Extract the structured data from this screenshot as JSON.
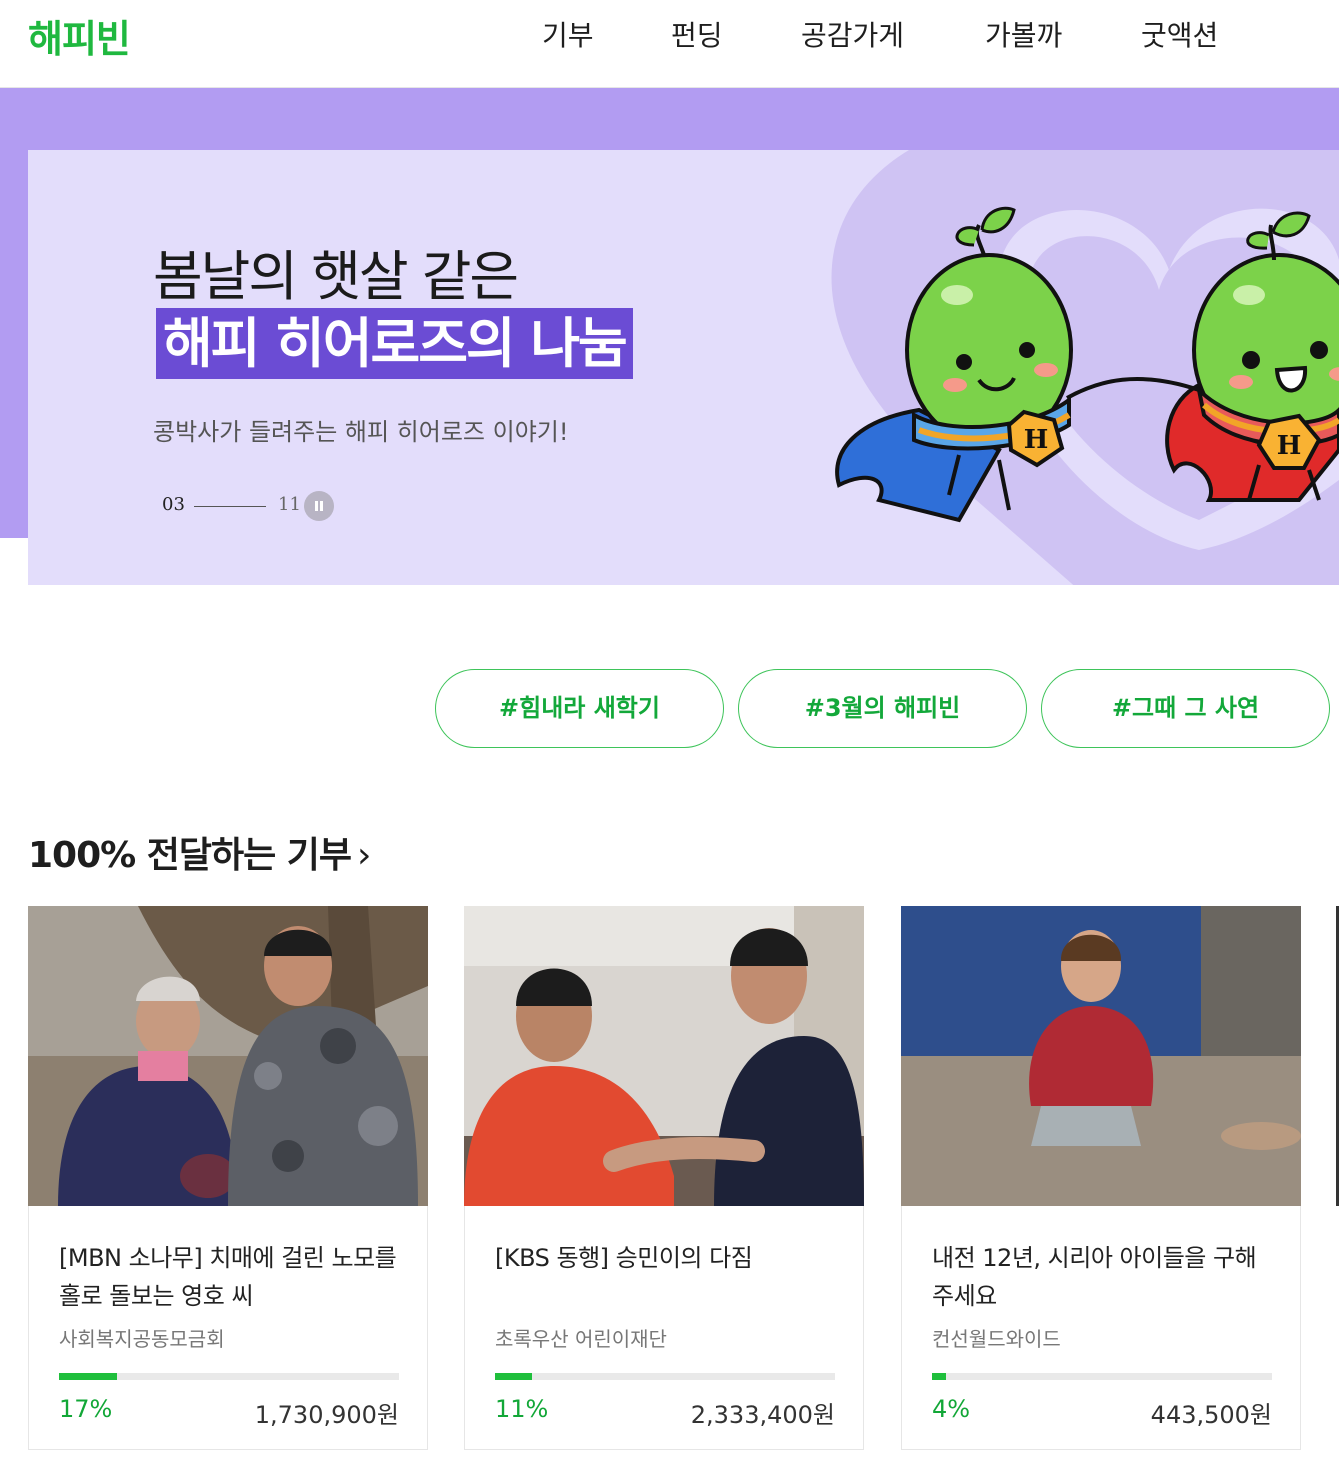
{
  "brand": {
    "logo": "해피빈",
    "accent": "#1fb83f"
  },
  "nav": {
    "items": [
      "기부",
      "펀딩",
      "공감가게",
      "가볼까",
      "굿액션"
    ]
  },
  "hero": {
    "title_line1": "봄날의 햇살 같은",
    "title_line2": "해피 히어로즈의 나눔",
    "subtitle": "콩박사가 들려주는 해피 히어로즈 이야기!",
    "slide_current": "03",
    "slide_total": "11",
    "mascot_badge": "H",
    "colors": {
      "band": "#b29cf2",
      "card": "#e3ddfb",
      "highlight": "#6b4cd4"
    }
  },
  "tags": [
    "#힘내라 새학기",
    "#3월의 해피빈",
    "#그때 그 사연"
  ],
  "section": {
    "title": "100% 전달하는 기부",
    "chevron": "›",
    "cards": [
      {
        "title": "[MBN 소나무] 치매에 걸린 노모를 홀로 돌보는 영호 씨",
        "org": "사회복지공동모금회",
        "percent_label": "17%",
        "percent": 17,
        "amount": "1,730,900원"
      },
      {
        "title": "[KBS 동행] 승민이의 다짐",
        "org": "초록우산 어린이재단",
        "percent_label": "11%",
        "percent": 11,
        "amount": "2,333,400원"
      },
      {
        "title": "내전 12년, 시리아 아이들을 구해주세요",
        "org": "컨선월드와이드",
        "percent_label": "4%",
        "percent": 4,
        "amount": "443,500원"
      }
    ]
  }
}
